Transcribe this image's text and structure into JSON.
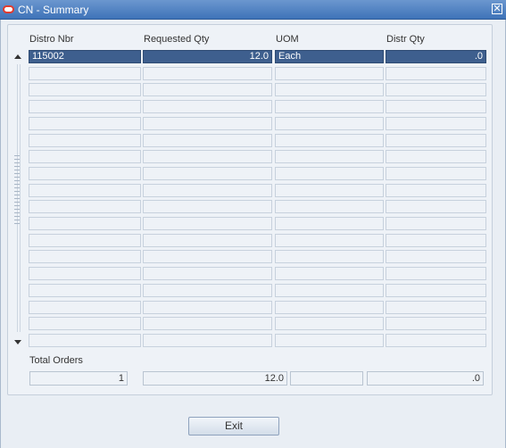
{
  "window": {
    "title": "CN - Summary",
    "close_symbol": "✕"
  },
  "table": {
    "headers": [
      "Distro Nbr",
      "Requested Qty",
      "UOM",
      "Distr Qty"
    ],
    "rows": [
      [
        "115002",
        "12.0",
        "Each",
        ".0"
      ],
      [
        "",
        "",
        "",
        ""
      ],
      [
        "",
        "",
        "",
        ""
      ],
      [
        "",
        "",
        "",
        ""
      ],
      [
        "",
        "",
        "",
        ""
      ],
      [
        "",
        "",
        "",
        ""
      ],
      [
        "",
        "",
        "",
        ""
      ],
      [
        "",
        "",
        "",
        ""
      ],
      [
        "",
        "",
        "",
        ""
      ],
      [
        "",
        "",
        "",
        ""
      ],
      [
        "",
        "",
        "",
        ""
      ],
      [
        "",
        "",
        "",
        ""
      ],
      [
        "",
        "",
        "",
        ""
      ],
      [
        "",
        "",
        "",
        ""
      ],
      [
        "",
        "",
        "",
        ""
      ],
      [
        "",
        "",
        "",
        ""
      ],
      [
        "",
        "",
        "",
        ""
      ],
      [
        "",
        "",
        "",
        ""
      ]
    ],
    "selected_row": 0
  },
  "totals": {
    "label": "Total Orders",
    "values": [
      "1",
      "12.0",
      "",
      ".0"
    ]
  },
  "buttons": {
    "exit_label": "Exit"
  },
  "colors": {
    "titlebar": "#3f73b8",
    "selection": "#3e5f8e",
    "background": "#e9eef4"
  }
}
